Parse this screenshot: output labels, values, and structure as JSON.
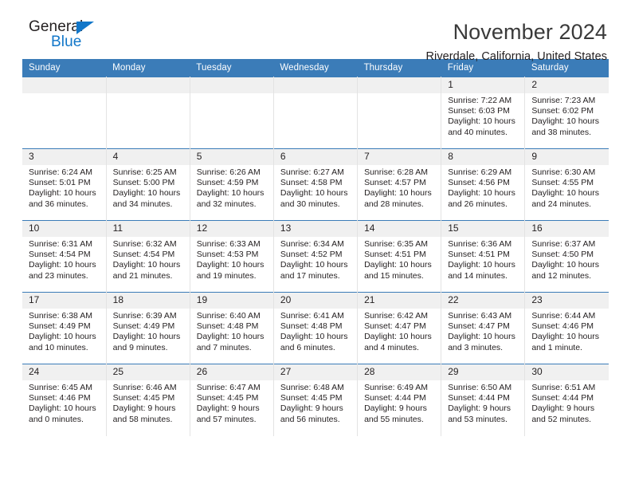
{
  "brand": {
    "name_top": "General",
    "name_bottom": "Blue",
    "accent_color": "#1277c9"
  },
  "header": {
    "title": "November 2024",
    "subtitle": "Riverdale, California, United States"
  },
  "theme": {
    "header_blue": "#3b7cb8",
    "daynum_band": "#f0f0f0",
    "text": "#231f20",
    "grid_line": "#e3e3e3"
  },
  "weekday_headers": [
    "Sunday",
    "Monday",
    "Tuesday",
    "Wednesday",
    "Thursday",
    "Friday",
    "Saturday"
  ],
  "labels": {
    "sunrise_prefix": "Sunrise:",
    "sunset_prefix": "Sunset:",
    "daylight_prefix": "Daylight:"
  },
  "weeks": [
    [
      {
        "day": "",
        "sunrise": "",
        "sunset": "",
        "daylight_line1": "",
        "daylight_line2": "",
        "empty": true
      },
      {
        "day": "",
        "sunrise": "",
        "sunset": "",
        "daylight_line1": "",
        "daylight_line2": "",
        "empty": true
      },
      {
        "day": "",
        "sunrise": "",
        "sunset": "",
        "daylight_line1": "",
        "daylight_line2": "",
        "empty": true
      },
      {
        "day": "",
        "sunrise": "",
        "sunset": "",
        "daylight_line1": "",
        "daylight_line2": "",
        "empty": true
      },
      {
        "day": "",
        "sunrise": "",
        "sunset": "",
        "daylight_line1": "",
        "daylight_line2": "",
        "empty": true
      },
      {
        "day": "1",
        "sunrise": "Sunrise: 7:22 AM",
        "sunset": "Sunset: 6:03 PM",
        "daylight_line1": "Daylight: 10 hours",
        "daylight_line2": "and 40 minutes.",
        "empty": false
      },
      {
        "day": "2",
        "sunrise": "Sunrise: 7:23 AM",
        "sunset": "Sunset: 6:02 PM",
        "daylight_line1": "Daylight: 10 hours",
        "daylight_line2": "and 38 minutes.",
        "empty": false
      }
    ],
    [
      {
        "day": "3",
        "sunrise": "Sunrise: 6:24 AM",
        "sunset": "Sunset: 5:01 PM",
        "daylight_line1": "Daylight: 10 hours",
        "daylight_line2": "and 36 minutes.",
        "empty": false
      },
      {
        "day": "4",
        "sunrise": "Sunrise: 6:25 AM",
        "sunset": "Sunset: 5:00 PM",
        "daylight_line1": "Daylight: 10 hours",
        "daylight_line2": "and 34 minutes.",
        "empty": false
      },
      {
        "day": "5",
        "sunrise": "Sunrise: 6:26 AM",
        "sunset": "Sunset: 4:59 PM",
        "daylight_line1": "Daylight: 10 hours",
        "daylight_line2": "and 32 minutes.",
        "empty": false
      },
      {
        "day": "6",
        "sunrise": "Sunrise: 6:27 AM",
        "sunset": "Sunset: 4:58 PM",
        "daylight_line1": "Daylight: 10 hours",
        "daylight_line2": "and 30 minutes.",
        "empty": false
      },
      {
        "day": "7",
        "sunrise": "Sunrise: 6:28 AM",
        "sunset": "Sunset: 4:57 PM",
        "daylight_line1": "Daylight: 10 hours",
        "daylight_line2": "and 28 minutes.",
        "empty": false
      },
      {
        "day": "8",
        "sunrise": "Sunrise: 6:29 AM",
        "sunset": "Sunset: 4:56 PM",
        "daylight_line1": "Daylight: 10 hours",
        "daylight_line2": "and 26 minutes.",
        "empty": false
      },
      {
        "day": "9",
        "sunrise": "Sunrise: 6:30 AM",
        "sunset": "Sunset: 4:55 PM",
        "daylight_line1": "Daylight: 10 hours",
        "daylight_line2": "and 24 minutes.",
        "empty": false
      }
    ],
    [
      {
        "day": "10",
        "sunrise": "Sunrise: 6:31 AM",
        "sunset": "Sunset: 4:54 PM",
        "daylight_line1": "Daylight: 10 hours",
        "daylight_line2": "and 23 minutes.",
        "empty": false
      },
      {
        "day": "11",
        "sunrise": "Sunrise: 6:32 AM",
        "sunset": "Sunset: 4:54 PM",
        "daylight_line1": "Daylight: 10 hours",
        "daylight_line2": "and 21 minutes.",
        "empty": false
      },
      {
        "day": "12",
        "sunrise": "Sunrise: 6:33 AM",
        "sunset": "Sunset: 4:53 PM",
        "daylight_line1": "Daylight: 10 hours",
        "daylight_line2": "and 19 minutes.",
        "empty": false
      },
      {
        "day": "13",
        "sunrise": "Sunrise: 6:34 AM",
        "sunset": "Sunset: 4:52 PM",
        "daylight_line1": "Daylight: 10 hours",
        "daylight_line2": "and 17 minutes.",
        "empty": false
      },
      {
        "day": "14",
        "sunrise": "Sunrise: 6:35 AM",
        "sunset": "Sunset: 4:51 PM",
        "daylight_line1": "Daylight: 10 hours",
        "daylight_line2": "and 15 minutes.",
        "empty": false
      },
      {
        "day": "15",
        "sunrise": "Sunrise: 6:36 AM",
        "sunset": "Sunset: 4:51 PM",
        "daylight_line1": "Daylight: 10 hours",
        "daylight_line2": "and 14 minutes.",
        "empty": false
      },
      {
        "day": "16",
        "sunrise": "Sunrise: 6:37 AM",
        "sunset": "Sunset: 4:50 PM",
        "daylight_line1": "Daylight: 10 hours",
        "daylight_line2": "and 12 minutes.",
        "empty": false
      }
    ],
    [
      {
        "day": "17",
        "sunrise": "Sunrise: 6:38 AM",
        "sunset": "Sunset: 4:49 PM",
        "daylight_line1": "Daylight: 10 hours",
        "daylight_line2": "and 10 minutes.",
        "empty": false
      },
      {
        "day": "18",
        "sunrise": "Sunrise: 6:39 AM",
        "sunset": "Sunset: 4:49 PM",
        "daylight_line1": "Daylight: 10 hours",
        "daylight_line2": "and 9 minutes.",
        "empty": false
      },
      {
        "day": "19",
        "sunrise": "Sunrise: 6:40 AM",
        "sunset": "Sunset: 4:48 PM",
        "daylight_line1": "Daylight: 10 hours",
        "daylight_line2": "and 7 minutes.",
        "empty": false
      },
      {
        "day": "20",
        "sunrise": "Sunrise: 6:41 AM",
        "sunset": "Sunset: 4:48 PM",
        "daylight_line1": "Daylight: 10 hours",
        "daylight_line2": "and 6 minutes.",
        "empty": false
      },
      {
        "day": "21",
        "sunrise": "Sunrise: 6:42 AM",
        "sunset": "Sunset: 4:47 PM",
        "daylight_line1": "Daylight: 10 hours",
        "daylight_line2": "and 4 minutes.",
        "empty": false
      },
      {
        "day": "22",
        "sunrise": "Sunrise: 6:43 AM",
        "sunset": "Sunset: 4:47 PM",
        "daylight_line1": "Daylight: 10 hours",
        "daylight_line2": "and 3 minutes.",
        "empty": false
      },
      {
        "day": "23",
        "sunrise": "Sunrise: 6:44 AM",
        "sunset": "Sunset: 4:46 PM",
        "daylight_line1": "Daylight: 10 hours",
        "daylight_line2": "and 1 minute.",
        "empty": false
      }
    ],
    [
      {
        "day": "24",
        "sunrise": "Sunrise: 6:45 AM",
        "sunset": "Sunset: 4:46 PM",
        "daylight_line1": "Daylight: 10 hours",
        "daylight_line2": "and 0 minutes.",
        "empty": false
      },
      {
        "day": "25",
        "sunrise": "Sunrise: 6:46 AM",
        "sunset": "Sunset: 4:45 PM",
        "daylight_line1": "Daylight: 9 hours",
        "daylight_line2": "and 58 minutes.",
        "empty": false
      },
      {
        "day": "26",
        "sunrise": "Sunrise: 6:47 AM",
        "sunset": "Sunset: 4:45 PM",
        "daylight_line1": "Daylight: 9 hours",
        "daylight_line2": "and 57 minutes.",
        "empty": false
      },
      {
        "day": "27",
        "sunrise": "Sunrise: 6:48 AM",
        "sunset": "Sunset: 4:45 PM",
        "daylight_line1": "Daylight: 9 hours",
        "daylight_line2": "and 56 minutes.",
        "empty": false
      },
      {
        "day": "28",
        "sunrise": "Sunrise: 6:49 AM",
        "sunset": "Sunset: 4:44 PM",
        "daylight_line1": "Daylight: 9 hours",
        "daylight_line2": "and 55 minutes.",
        "empty": false
      },
      {
        "day": "29",
        "sunrise": "Sunrise: 6:50 AM",
        "sunset": "Sunset: 4:44 PM",
        "daylight_line1": "Daylight: 9 hours",
        "daylight_line2": "and 53 minutes.",
        "empty": false
      },
      {
        "day": "30",
        "sunrise": "Sunrise: 6:51 AM",
        "sunset": "Sunset: 4:44 PM",
        "daylight_line1": "Daylight: 9 hours",
        "daylight_line2": "and 52 minutes.",
        "empty": false
      }
    ]
  ]
}
